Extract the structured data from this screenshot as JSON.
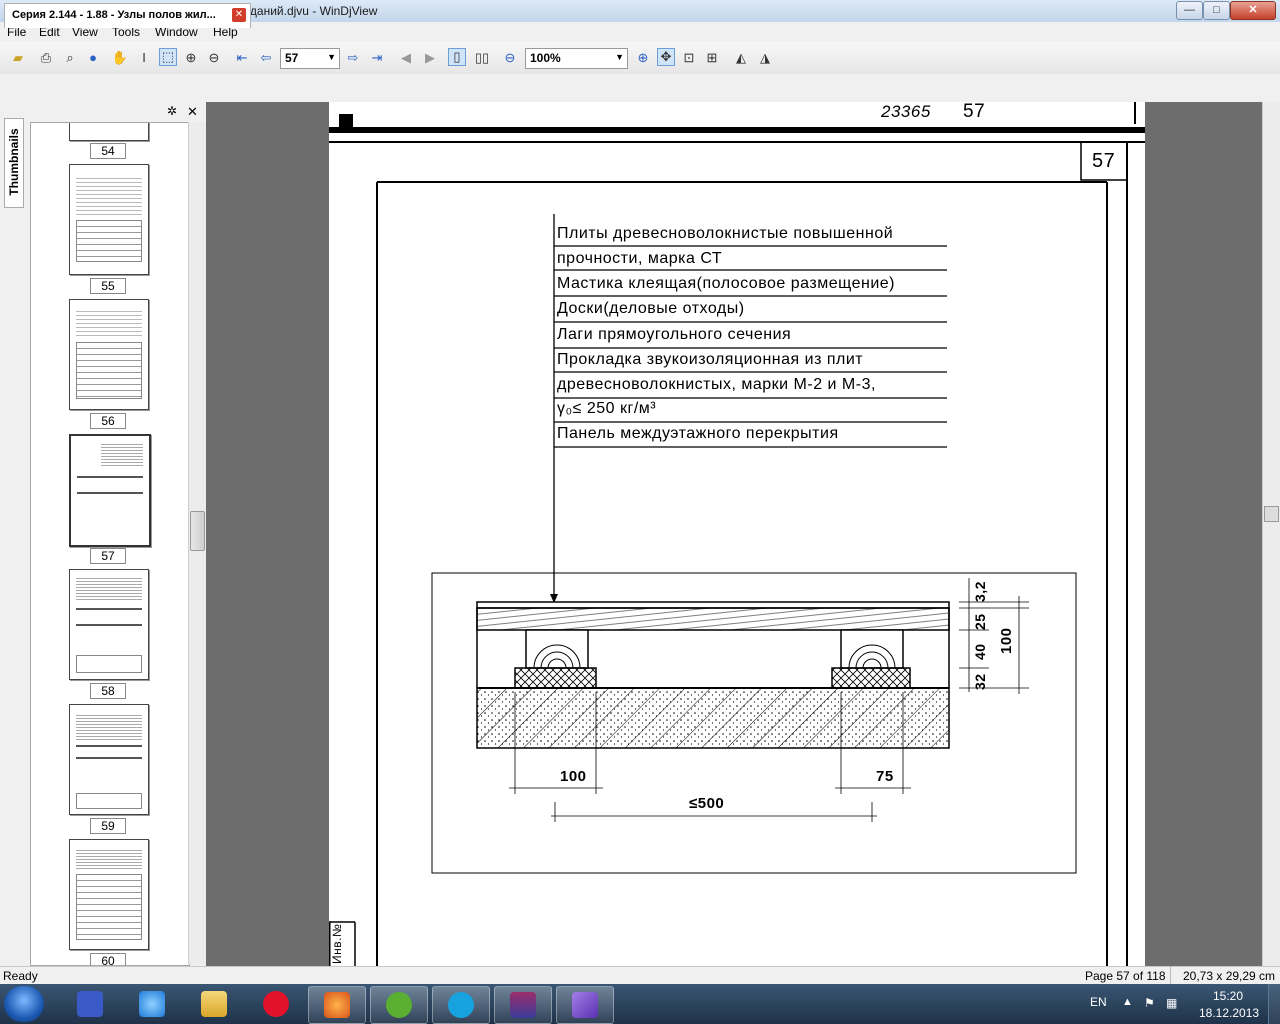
{
  "window": {
    "title": "Серия 2.144 - 1.88 - Узлы полов жилых зданий.djvu - WinDjView",
    "minimize": "—",
    "maximize": "□",
    "close": "✕"
  },
  "menu": [
    "File",
    "Edit",
    "View",
    "Tools",
    "Window",
    "Help"
  ],
  "toolbar": {
    "page_number": "57",
    "zoom": "100%"
  },
  "tab": {
    "label": "Серия 2.144 - 1.88 - Узлы полов жил...",
    "close": "✕"
  },
  "sidebar": {
    "tab_label": "Thumbnails",
    "close": "✕",
    "thumbnails": [
      {
        "page": "54"
      },
      {
        "page": "55"
      },
      {
        "page": "56"
      },
      {
        "page": "57"
      },
      {
        "page": "58"
      },
      {
        "page": "59"
      },
      {
        "page": "60"
      }
    ]
  },
  "document": {
    "header_code": "23365",
    "header_page": "57",
    "page_box_number": "57",
    "legend": [
      "Плиты древесноволокнистые повышенной",
      "прочности, марка СТ",
      "Мастика клеящая(полосовое размещение)",
      "Доски(деловые отходы)",
      "Лаги прямоугольного сечения",
      "Прокладка звукоизоляционная из плит",
      "древесноволокнистых, марки М-2 и М-3,",
      "γ₀≤ 250 кг/м³",
      "Панель междуэтажного перекрытия"
    ],
    "dims": {
      "d1": "3,2",
      "d2": "25",
      "d3": "40",
      "d4": "32",
      "total": "100",
      "left_width": "100",
      "right_width": "75",
      "spacing": "≤500"
    },
    "side_stamp": "Инв.№"
  },
  "status": {
    "left": "Ready",
    "page_info": "Page 57 of 118",
    "size": "20,73 x 29,29 cm"
  },
  "taskbar": {
    "lang": "EN",
    "time": "15:20",
    "date": "18.12.2013"
  }
}
